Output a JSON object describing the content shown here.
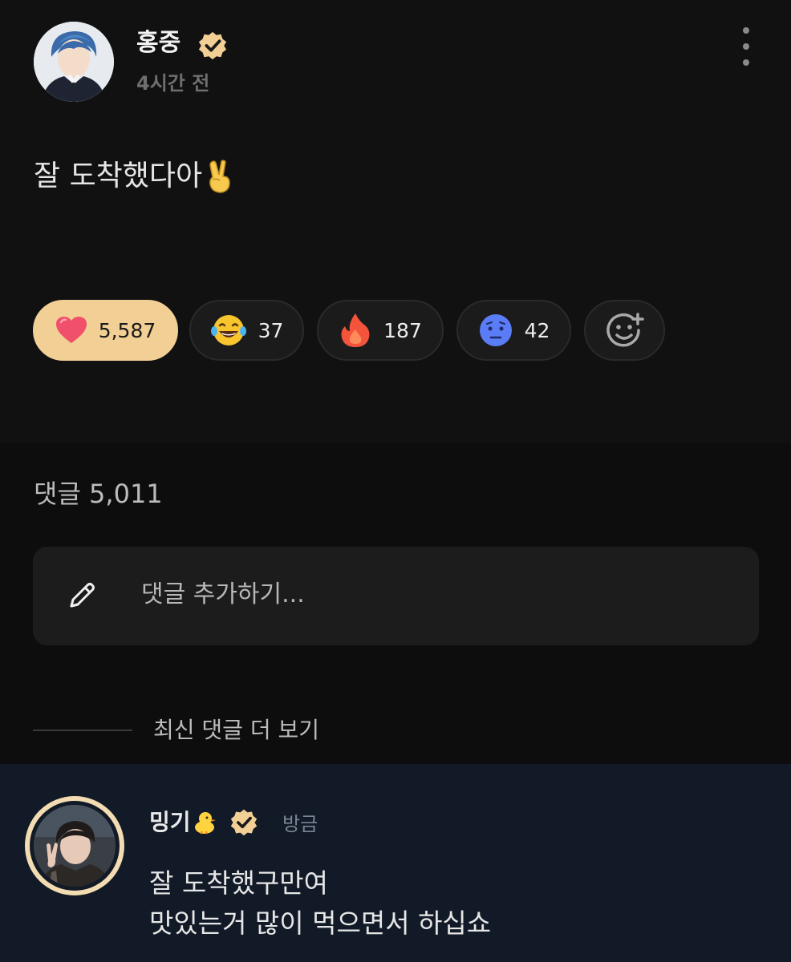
{
  "post": {
    "author": "홍중",
    "time": "4시간 전",
    "body": "잘 도착했다아",
    "body_emoji": "victory-hand-emoji",
    "verified": true
  },
  "reactions": [
    {
      "icon": "heart-icon",
      "count": "5,587",
      "active": true,
      "color": "#f0506a"
    },
    {
      "icon": "laughing-tears-icon",
      "count": "37",
      "active": false,
      "color": "#f7c62f"
    },
    {
      "icon": "fire-icon",
      "count": "187",
      "active": false,
      "color": "#f4533c"
    },
    {
      "icon": "worried-face-icon",
      "count": "42",
      "active": false,
      "color": "#5b7cf7"
    }
  ],
  "add_reaction_icon": "add-emoji-icon",
  "comments": {
    "label": "댓글 5,011",
    "input_placeholder": "댓글 추가하기...",
    "more_link": "최신 댓글 더 보기"
  },
  "top_comment": {
    "author": "밍기",
    "author_emoji": "baby-chick-emoji",
    "time": "방금",
    "verified": true,
    "lines": [
      "잘 도착했구만여",
      "맛있는거 많이 먹으면서 하십쇼"
    ]
  },
  "colors": {
    "background": "#111111",
    "accent": "#f2cf94",
    "comment_highlight": "#111a26",
    "input_bg": "#1c1c1c"
  }
}
